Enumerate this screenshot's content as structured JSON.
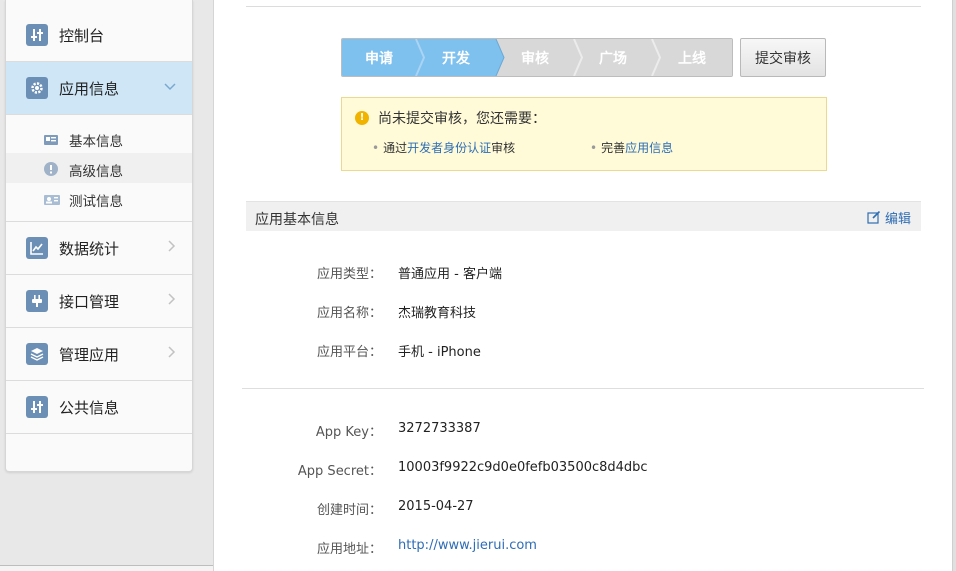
{
  "sidebar": {
    "items": [
      {
        "label": "控制台",
        "icon": "sliders-icon"
      },
      {
        "label": "应用信息",
        "icon": "gear-icon",
        "chevron": "⌄"
      },
      {
        "label": "数据统计",
        "icon": "line-chart-icon",
        "chevron": "›"
      },
      {
        "label": "接口管理",
        "icon": "plug-icon",
        "chevron": "›"
      },
      {
        "label": "管理应用",
        "icon": "layers-icon",
        "chevron": "›"
      },
      {
        "label": "公共信息",
        "icon": "sliders-icon"
      }
    ],
    "sub_items": [
      {
        "label": "基本信息",
        "icon": "id-card-icon"
      },
      {
        "label": "高级信息",
        "icon": "info-icon"
      },
      {
        "label": "测试信息",
        "icon": "user-card-icon"
      }
    ]
  },
  "steps": [
    {
      "label": "申请",
      "state": "done"
    },
    {
      "label": "开发",
      "state": "done"
    },
    {
      "label": "审核",
      "state": "todo"
    },
    {
      "label": "广场",
      "state": "todo"
    },
    {
      "label": "上线",
      "state": "todo"
    }
  ],
  "submit_button": "提交审核",
  "notice": {
    "title": "尚未提交审核，您还需要：",
    "req1_prefix": "通过",
    "req1_link": "开发者身份认证",
    "req1_suffix": "审核",
    "req2_prefix": "完善",
    "req2_link": "应用信息"
  },
  "section": {
    "title": "应用基本信息",
    "edit_label": "编辑"
  },
  "basic": {
    "type_label": "应用类型：",
    "type_value": "普通应用  -  客户端",
    "name_label": "应用名称：",
    "name_value": "杰瑞教育科技",
    "platform_label": "应用平台：",
    "platform_value": "手机  -  iPhone"
  },
  "keys": {
    "app_key_label": "App Key：",
    "app_key_value": "3272733387",
    "app_secret_label": "App Secret：",
    "app_secret_value": "10003f9922c9d0e0fefb03500c8d4dbc",
    "created_label": "创建时间：",
    "created_value": "2015-04-27",
    "url_label": "应用地址：",
    "url_value": "http://www.jierui.com"
  },
  "colors": {
    "accent": "#2e6db4",
    "step_done": "#7ec0ee",
    "step_todo": "#d8d8d8",
    "active_nav": "#cfe6f7",
    "notice_bg": "#fffbd9"
  }
}
